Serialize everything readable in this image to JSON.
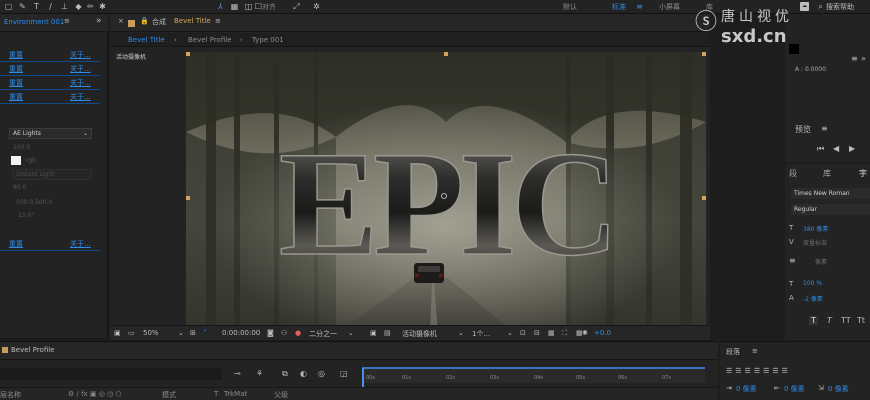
{
  "toolbar": {
    "tools": [
      "▢",
      "✎",
      "T",
      "∕",
      "◆",
      "✏",
      "✱"
    ],
    "align_label": "对齐",
    "workspaces": [
      "默认",
      "标准",
      "小屏幕",
      "库"
    ],
    "active_workspace": "标准",
    "search_placeholder": "搜索帮助",
    "dblarrow": "»"
  },
  "effect_panel": {
    "tab_title": "Environment 001",
    "menu": "≡",
    "more": "»",
    "rows": [
      {
        "left": "重置",
        "right": "关于..."
      },
      {
        "left": "重置",
        "right": "关于..."
      },
      {
        "left": "重置",
        "right": "关于..."
      },
      {
        "left": "重置",
        "right": "关于..."
      }
    ],
    "lights_select": "AE Lights",
    "dim_texts": [
      "100.0",
      "100.0"
    ],
    "swatch_label": "rgb",
    "locked_select": "Distant Light",
    "dim_values": [
      "80.0",
      "500.0,500.0",
      "15.0°"
    ],
    "bottom_row": {
      "left": "重置",
      "right": "关于..."
    }
  },
  "comp": {
    "header_prefix": "合成",
    "title": "Bevel Title",
    "menu": "≡",
    "tabs": [
      "Bevel Title",
      "Bevel Profile",
      "Type 001"
    ],
    "camera_label": "活动摄像机",
    "epic_text": "EPIC",
    "footer": {
      "zoom": "50%",
      "timecode": "0:00:00:00",
      "resolution": "二分之一",
      "camera": "活动摄像机",
      "views": "1个...",
      "offset": "+0.0"
    }
  },
  "watermark": {
    "text": "唐山视优",
    "url": "sxd.cn"
  },
  "right_panel": {
    "alpha_label": "A : 0.0000",
    "preview_label": "预览",
    "preview_menu": "≡",
    "char_tabs": [
      "段",
      "库",
      "字"
    ],
    "font_family": "Times New Roman",
    "font_style": "Regular",
    "font_size": "380 像素",
    "tracking": "度量标准",
    "leading_unit": "像素",
    "vscale": "100 %",
    "baseline": "-2 像素",
    "style_buttons": [
      "T",
      "T",
      "TT",
      "Tt"
    ]
  },
  "timeline": {
    "tab_title": "Bevel Profile",
    "ruler_labels": [
      "00s",
      "01s",
      "02s",
      "03s",
      "04s",
      "05s",
      "06s",
      "07s"
    ],
    "col_name": "层名称",
    "col_mode": "模式",
    "col_t": "T",
    "col_trkmat": "TrkMat",
    "col_parent": "父级"
  },
  "paragraph_panel": {
    "title": "段落",
    "menu": "≡",
    "indent_values": [
      "0 像素",
      "0 像素",
      "0 像素"
    ]
  }
}
